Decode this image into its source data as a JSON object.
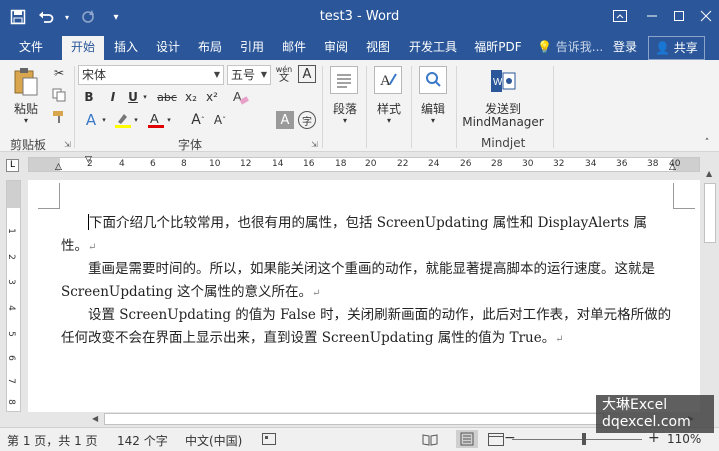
{
  "app": {
    "title": "test3 - Word",
    "accent": "#2b579a"
  },
  "qat": {
    "save_icon": "save-icon",
    "undo_icon": "undo-icon",
    "redo_icon": "redo-icon",
    "customize_icon": "customize-qat-icon"
  },
  "tabs": [
    {
      "label": "文件"
    },
    {
      "label": "开始"
    },
    {
      "label": "插入"
    },
    {
      "label": "设计"
    },
    {
      "label": "布局"
    },
    {
      "label": "引用"
    },
    {
      "label": "邮件"
    },
    {
      "label": "审阅"
    },
    {
      "label": "视图"
    },
    {
      "label": "开发工具"
    },
    {
      "label": "福昕PDF"
    }
  ],
  "tell_me": "告诉我...",
  "login": "登录",
  "share": "共享",
  "ribbon": {
    "clipboard": {
      "paste": "粘贴",
      "label": "剪贴板"
    },
    "font": {
      "name": "宋体",
      "size": "五号",
      "wen": "wén",
      "bold": "B",
      "italic": "I",
      "underline": "U",
      "strike": "abc",
      "subscript": "x₂",
      "superscript": "x²",
      "grow": "A",
      "shrink": "A",
      "char_shading": "A",
      "enclose": "字",
      "border_char": "A",
      "label": "字体"
    },
    "paragraph": {
      "label": "段落"
    },
    "styles": {
      "label": "样式"
    },
    "editing": {
      "label": "编辑"
    },
    "mindjet": {
      "line1": "发送到",
      "line2": "MindManager",
      "label": "Mindjet"
    }
  },
  "ruler": {
    "numbers": [
      "2",
      "4",
      "6",
      "8",
      "10",
      "12",
      "14",
      "16",
      "18",
      "20",
      "22",
      "24",
      "26",
      "28",
      "30",
      "32",
      "34",
      "36",
      "38",
      "40"
    ],
    "corner": "L"
  },
  "vruler_numbers": [
    "1",
    "2",
    "3",
    "4",
    "5",
    "6",
    "7",
    "8"
  ],
  "document": {
    "paragraphs": [
      "下面介绍几个比较常用，也很有用的属性，包括 ScreenUpdating 属性和 DisplayAlerts 属性。",
      "重画是需要时间的。所以，如果能关闭这个重画的动作，就能显著提高脚本的运行速度。这就是 ScreenUpdating 这个属性的意义所在。",
      "设置 ScreenUpdating 的值为 False 时，关闭刷新画面的动作，此后对工作表，对单元格所做的任何改变不会在界面上显示出来，直到设置 ScreenUpdating 属性的值为 True。"
    ],
    "para_mark": "↵"
  },
  "status": {
    "page": "第 1 页，共 1 页",
    "words": "142 个字",
    "lang": "中文(中国)",
    "zoom": "110%"
  },
  "watermark": {
    "line1": "大琳Excel",
    "line2": "dqexcel.com"
  }
}
